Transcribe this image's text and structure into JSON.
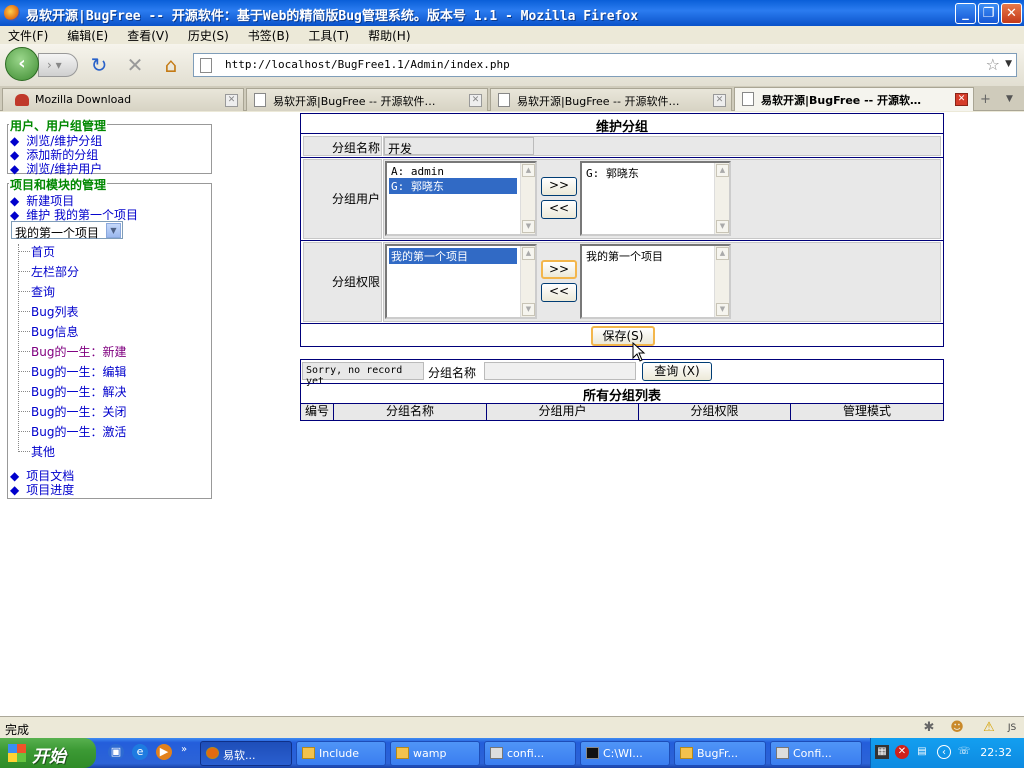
{
  "window": {
    "title": "易软开源|BugFree -- 开源软件：基于Web的精简版Bug管理系统。版本号 1.1 - Mozilla Firefox",
    "minimize": "_",
    "restore": "❐",
    "close": "✕"
  },
  "menu": [
    "文件(F)",
    "编辑(E)",
    "查看(V)",
    "历史(S)",
    "书签(B)",
    "工具(T)",
    "帮助(H)"
  ],
  "nav": {
    "url": "http://localhost/BugFree1.1/Admin/index.php",
    "back": "‹",
    "forward": "›",
    "reload": "↻",
    "stop": "✕",
    "home": "⌂"
  },
  "tabs": [
    {
      "label": "Mozilla Download"
    },
    {
      "label": "易软开源|BugFree -- 开源软件…"
    },
    {
      "label": "易软开源|BugFree -- 开源软件…"
    },
    {
      "label": "易软开源|BugFree -- 开源软…"
    }
  ],
  "sidebar": {
    "section1_title": "用户、用户组管理",
    "section1_links": [
      "浏览/维护分组",
      "添加新的分组",
      "浏览/维护用户"
    ],
    "section2_title": "项目和模块的管理",
    "section2_links": [
      "新建项目",
      "维护 我的第一个项目"
    ],
    "project_select": "我的第一个项目",
    "tree": [
      "首页",
      "左栏部分",
      "查询",
      "Bug列表",
      "Bug信息",
      "Bug的一生：新建",
      "Bug的一生：编辑",
      "Bug的一生：解决",
      "Bug的一生：关闭",
      "Bug的一生：激活",
      "其他"
    ],
    "bottom_links": [
      "项目文档",
      "项目进度"
    ]
  },
  "form": {
    "title": "维护分组",
    "group_name_label": "分组名称",
    "group_name_value": "开发",
    "group_users_label": "分组用户",
    "users_available": [
      "A: admin",
      "G: 郭晓东"
    ],
    "users_selected": [
      "G: 郭晓东"
    ],
    "group_perm_label": "分组权限",
    "perm_available": [
      "我的第一个项目"
    ],
    "perm_selected": [
      "我的第一个项目"
    ],
    "add_button": ">>",
    "remove_button": "<<",
    "save_button": "保存(S)"
  },
  "search": {
    "message": "Sorry, no record yet",
    "label": "分组名称",
    "query_button": "查询 (X)"
  },
  "list": {
    "title": "所有分组列表",
    "columns": [
      "编号",
      "分组名称",
      "分组用户",
      "分组权限",
      "管理模式"
    ]
  },
  "status": {
    "text": "完成"
  },
  "taskbar": {
    "start": "开始",
    "tasks": [
      "易软...",
      "Include",
      "wamp",
      "confi...",
      "C:\\WI...",
      "BugFr...",
      "Confi..."
    ],
    "clock": "22:32"
  }
}
